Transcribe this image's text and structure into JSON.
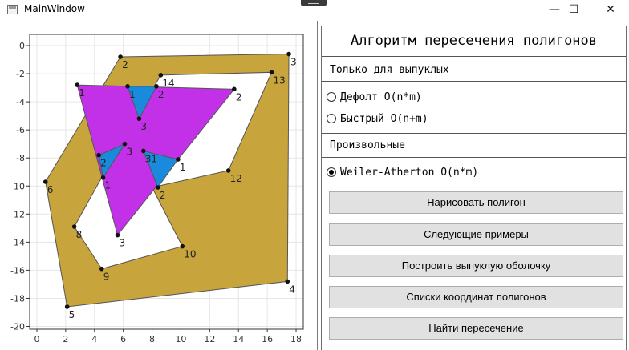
{
  "window": {
    "title": "MainWindow",
    "minimize_glyph": "—",
    "maximize_glyph": "☐",
    "close_glyph": "✕"
  },
  "panel": {
    "title": "Алгоритм пересечения полигонов",
    "convex_section": "Только для выпуклых",
    "radio_default": "Дефолт O(n*m)",
    "radio_fast": "Быстрый O(n+m)",
    "arbitrary_section": "Произвольные",
    "radio_weiler": "Weiler-Atherton O(n*m)",
    "selected_algorithm": "Weiler-Atherton O(n*m)"
  },
  "buttons": {
    "draw_polygon": "Нарисовать полигон",
    "next_examples": "Следующие примеры",
    "build_hull": "Построить выпуклую оболочку",
    "coordinate_lists": "Списки координат полигонов",
    "find_intersection": "Найти пересечение"
  },
  "chart_data": {
    "type": "scatter",
    "title": "",
    "xlabel": "",
    "ylabel": "",
    "xlim": [
      -0.5,
      18.5
    ],
    "ylim": [
      -20.2,
      0.8
    ],
    "xticks": [
      "0",
      "2",
      "4",
      "6",
      "8",
      "10",
      "12",
      "14",
      "16",
      "18"
    ],
    "yticks": [
      "0",
      "-2",
      "-4",
      "-6",
      "-8",
      "-10",
      "-12",
      "-14",
      "-16",
      "-18",
      "-20"
    ],
    "grid": true,
    "colors": {
      "gold": "#c8a43c",
      "purple": "#c230e8",
      "blue": "#1a8adc"
    },
    "polygons": [
      {
        "fill": "gold",
        "role": "outer",
        "points": [
          [
            5.8,
            -0.8
          ],
          [
            17.5,
            -0.6
          ],
          [
            17.4,
            -16.8
          ],
          [
            2.1,
            -18.6
          ],
          [
            0.6,
            -9.7
          ]
        ]
      },
      {
        "fill": "white",
        "role": "hole",
        "points": [
          [
            8.6,
            -2.1
          ],
          [
            16.3,
            -1.9
          ],
          [
            13.3,
            -8.9
          ],
          [
            8.0,
            -10.1
          ],
          [
            10.1,
            -14.3
          ],
          [
            4.5,
            -15.9
          ],
          [
            2.6,
            -12.9
          ],
          [
            4.5,
            -9.4
          ]
        ]
      },
      {
        "fill": "purple",
        "role": "triangle",
        "points": [
          [
            2.8,
            -2.8
          ],
          [
            13.7,
            -3.1
          ],
          [
            5.6,
            -13.5
          ]
        ]
      },
      {
        "fill": "blue",
        "role": "intersection",
        "points": [
          [
            6.3,
            -2.9
          ],
          [
            8.3,
            -2.9
          ],
          [
            7.1,
            -5.2
          ]
        ]
      },
      {
        "fill": "blue",
        "role": "intersection",
        "points": [
          [
            4.3,
            -7.8
          ],
          [
            6.1,
            -7.0
          ],
          [
            4.6,
            -9.4
          ]
        ]
      },
      {
        "fill": "blue",
        "role": "intersection",
        "points": [
          [
            7.4,
            -7.5
          ],
          [
            9.8,
            -8.1
          ],
          [
            8.4,
            -10.1
          ]
        ]
      }
    ],
    "points": [
      {
        "x": 5.8,
        "y": -0.8,
        "label": "2"
      },
      {
        "x": 17.5,
        "y": -0.6,
        "label": "3"
      },
      {
        "x": 8.6,
        "y": -2.1,
        "label": "14"
      },
      {
        "x": 16.3,
        "y": -1.9,
        "label": "13"
      },
      {
        "x": 2.8,
        "y": -2.8,
        "label": "1"
      },
      {
        "x": 6.3,
        "y": -2.9,
        "label": "1"
      },
      {
        "x": 8.3,
        "y": -2.9,
        "label": "2"
      },
      {
        "x": 13.7,
        "y": -3.1,
        "label": "2"
      },
      {
        "x": 7.1,
        "y": -5.2,
        "label": "3"
      },
      {
        "x": 6.1,
        "y": -7.0,
        "label": "3"
      },
      {
        "x": 7.4,
        "y": -7.5,
        "label": "31"
      },
      {
        "x": 4.3,
        "y": -7.8,
        "label": "2"
      },
      {
        "x": 9.8,
        "y": -8.1,
        "label": "1"
      },
      {
        "x": 13.3,
        "y": -8.9,
        "label": "12"
      },
      {
        "x": 4.6,
        "y": -9.4,
        "label": "1"
      },
      {
        "x": 0.6,
        "y": -9.7,
        "label": "6"
      },
      {
        "x": 8.4,
        "y": -10.1,
        "label": "2"
      },
      {
        "x": 2.6,
        "y": -12.9,
        "label": "8"
      },
      {
        "x": 5.6,
        "y": -13.5,
        "label": "3"
      },
      {
        "x": 10.1,
        "y": -14.3,
        "label": "10"
      },
      {
        "x": 4.5,
        "y": -15.9,
        "label": "9"
      },
      {
        "x": 17.4,
        "y": -16.8,
        "label": "4"
      },
      {
        "x": 2.1,
        "y": -18.6,
        "label": "5"
      }
    ]
  }
}
